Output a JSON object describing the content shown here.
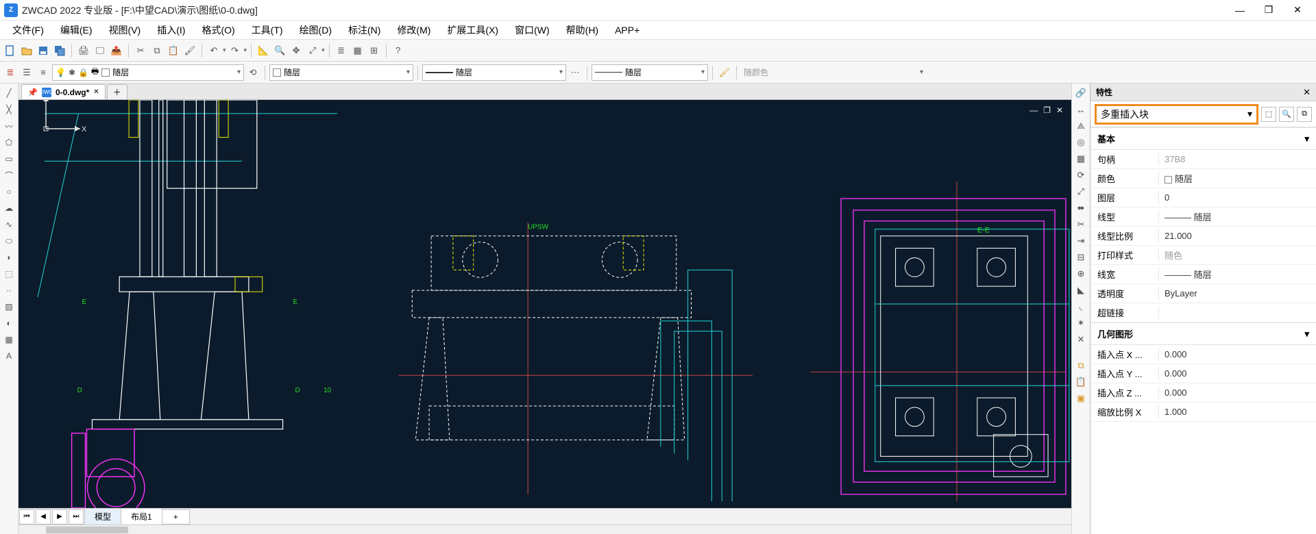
{
  "title": "ZWCAD 2022 专业版 - [F:\\中望CAD\\演示\\图纸\\0-0.dwg]",
  "app_icon_label": "Z",
  "menu": [
    "文件(F)",
    "编辑(E)",
    "视图(V)",
    "插入(I)",
    "格式(O)",
    "工具(T)",
    "绘图(D)",
    "标注(N)",
    "修改(M)",
    "扩展工具(X)",
    "窗口(W)",
    "帮助(H)",
    "APP+"
  ],
  "toolbar2": {
    "layer_selector": "随层",
    "linetype_selector": "随层",
    "lineweight_selector": "随层",
    "color_selector": "随颜色"
  },
  "file_tab": {
    "label": "0-0.dwg*",
    "pinned": "📌"
  },
  "model_tabs": {
    "model": "模型",
    "layout1": "布局1",
    "plus": "+"
  },
  "properties": {
    "panel_title": "特性",
    "selector_value": "多重插入块",
    "sections": [
      {
        "title": "基本",
        "rows": [
          {
            "k": "句柄",
            "v": "37B8",
            "muted": true
          },
          {
            "k": "颜色",
            "v": "随层",
            "swatch": "#ffffff"
          },
          {
            "k": "图层",
            "v": "0"
          },
          {
            "k": "线型",
            "v": "——— 随层"
          },
          {
            "k": "线型比例",
            "v": "21.000"
          },
          {
            "k": "打印样式",
            "v": "随色",
            "muted": true
          },
          {
            "k": "线宽",
            "v": "——— 随层"
          },
          {
            "k": "透明度",
            "v": "ByLayer"
          },
          {
            "k": "超链接",
            "v": ""
          }
        ]
      },
      {
        "title": "几何图形",
        "rows": [
          {
            "k": "插入点 X ...",
            "v": "0.000"
          },
          {
            "k": "插入点 Y ...",
            "v": "0.000"
          },
          {
            "k": "插入点 Z ...",
            "v": "0.000"
          },
          {
            "k": "缩放比例 X",
            "v": "1.000"
          }
        ]
      }
    ]
  },
  "drawing_labels": {
    "upsw": "UPSW",
    "ee": "E-E",
    "d": "D",
    "e": "E",
    "ten": "10"
  }
}
